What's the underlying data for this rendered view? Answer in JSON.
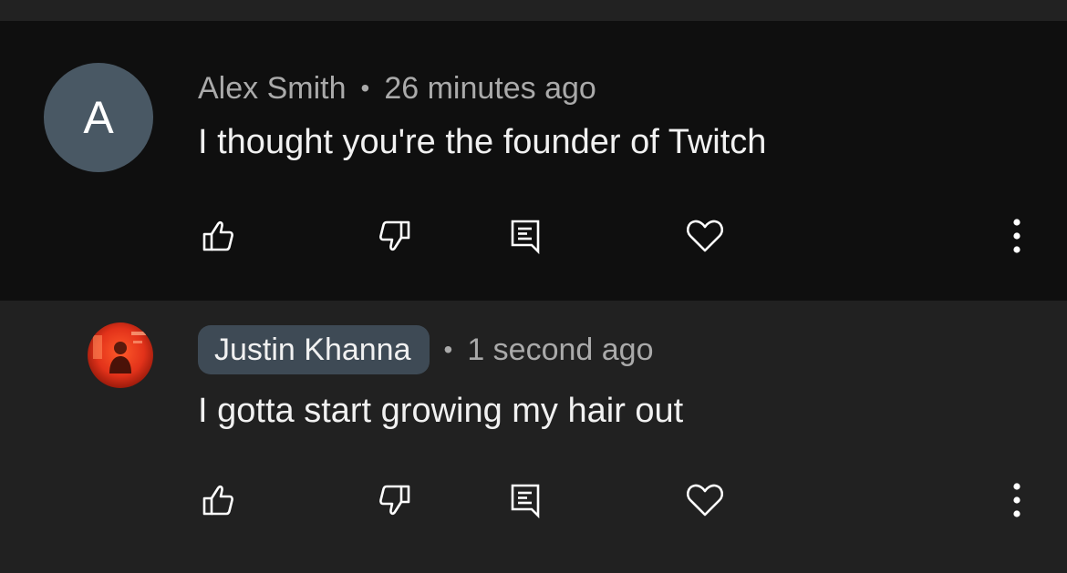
{
  "comments": [
    {
      "avatar_letter": "A",
      "author": "Alex Smith",
      "separator": "•",
      "time": "26 minutes ago",
      "text": "I thought you're the founder of Twitch",
      "avatar_color": "#495864"
    },
    {
      "author": "Justin Khanna",
      "separator": "•",
      "time": "1 second ago",
      "text": "I gotta start growing my hair out",
      "author_chip_color": "#3e4a55"
    }
  ],
  "icons": [
    "thumbs-up-icon",
    "thumbs-down-icon",
    "reply-icon",
    "heart-icon",
    "more-vert-icon"
  ],
  "colors": {
    "main_comment_bg": "#0f0f0f",
    "reply_bg": "#212121",
    "text_primary": "#f1f1f1",
    "text_secondary": "#aaaaaa"
  }
}
